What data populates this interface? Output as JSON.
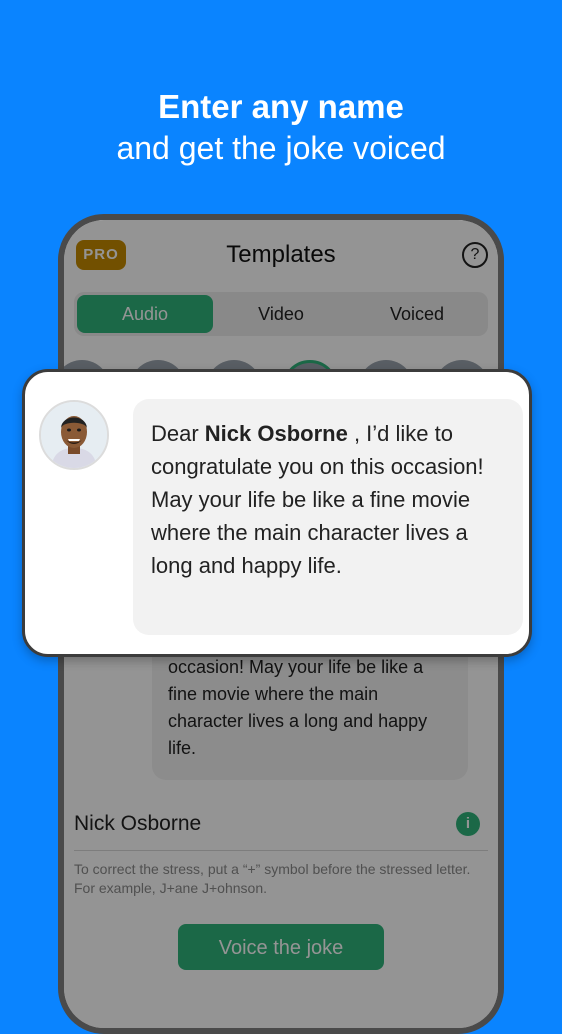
{
  "headline": {
    "line1": "Enter any name",
    "line2": "and get the joke voiced"
  },
  "app": {
    "pro_badge": "PRO",
    "title": "Templates",
    "help_icon": "question-circle-icon",
    "help_glyph": "?",
    "tabs": [
      {
        "label": "Audio",
        "active": true
      },
      {
        "label": "Video",
        "active": false
      },
      {
        "label": "Voiced",
        "active": false
      }
    ],
    "message_fragment": "occasion! May your life be like a fine movie where the main character lives a long and happy life.",
    "name_value": "Nick Osborne",
    "info_icon": "info-icon",
    "info_glyph": "i",
    "hint": "To correct the stress, put a “+” symbol before the stressed letter. For example, J+ane J+ohnson.",
    "voice_button": "Voice the joke"
  },
  "card": {
    "greeting": "Dear ",
    "name": "Nick Osborne",
    "after_name": " , I’d like to congratulate you on this occasion! May your life be like a fine movie where the main character lives a long and happy life."
  },
  "colors": {
    "background": "#0a84ff",
    "accent": "#2fb37b",
    "pro": "#c58b00"
  }
}
